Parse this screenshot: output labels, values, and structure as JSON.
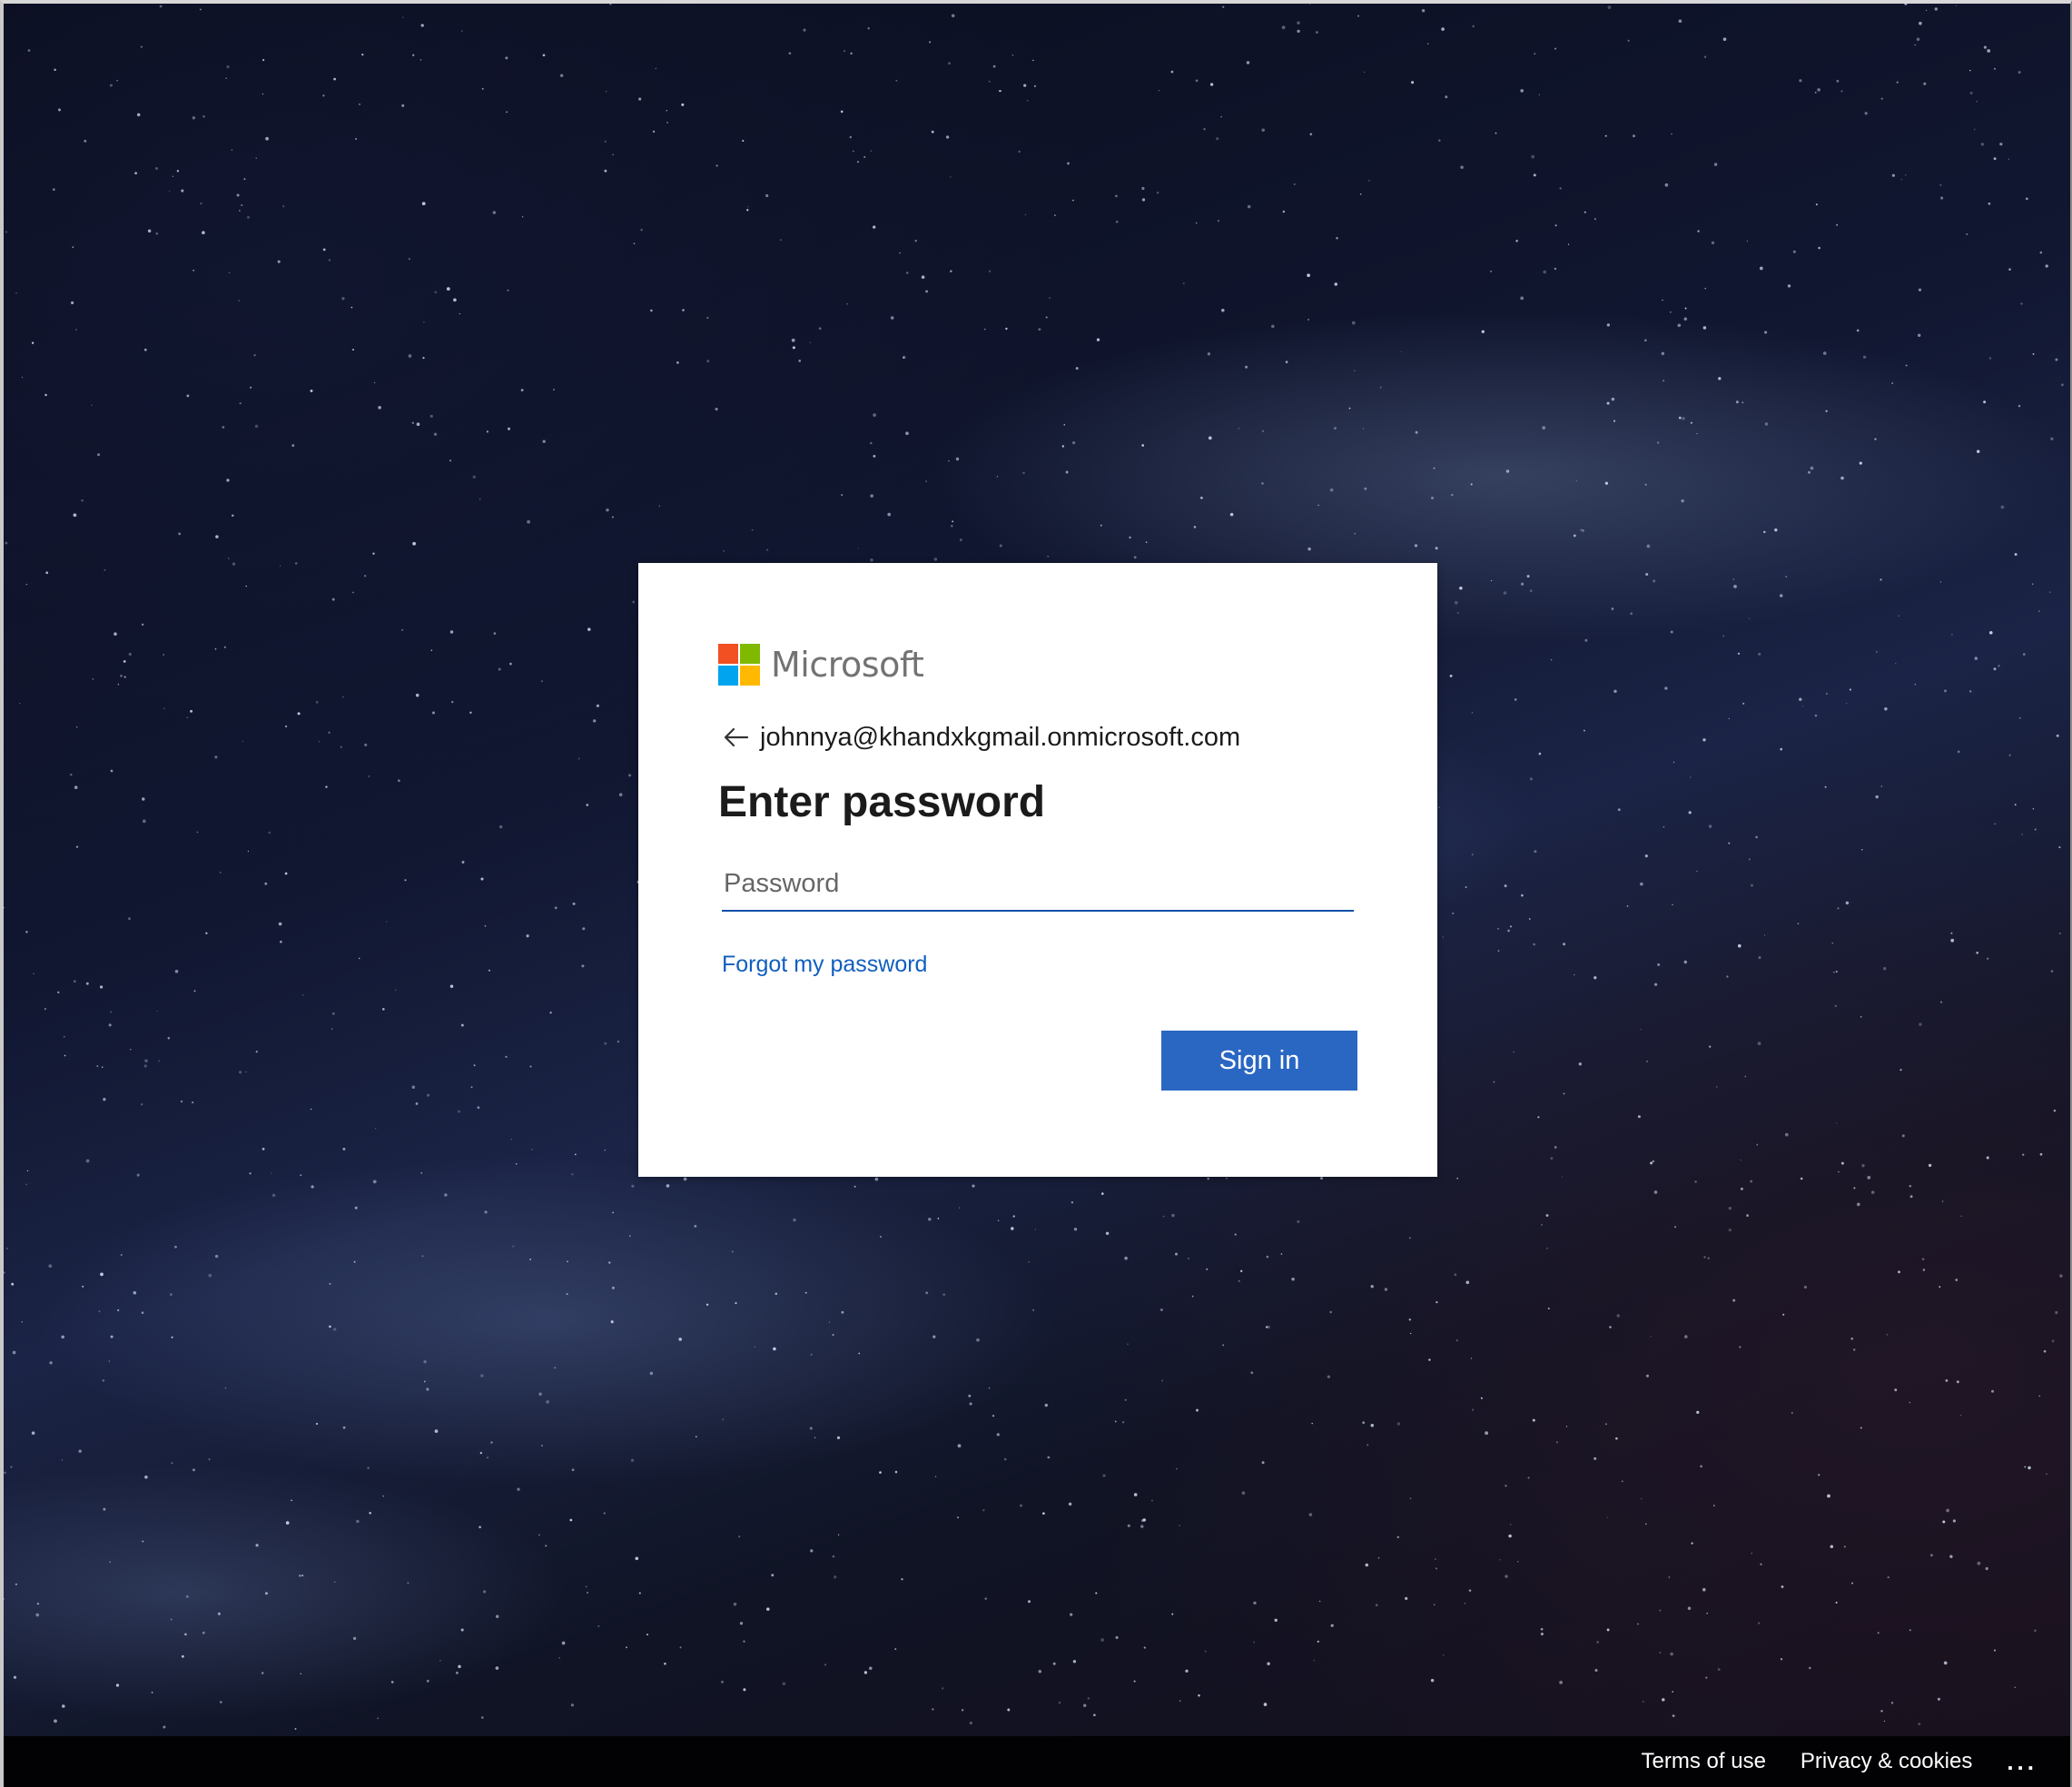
{
  "brand": {
    "name": "Microsoft",
    "colors": {
      "red": "#f25022",
      "green": "#7fba00",
      "blue": "#00a4ef",
      "yellow": "#ffb900"
    }
  },
  "signin": {
    "identity": "johnnya@khandxkgmail.onmicrosoft.com",
    "back_icon": "arrow-left-icon",
    "title": "Enter password",
    "password_placeholder": "Password",
    "password_value": "",
    "forgot_label": "Forgot my password",
    "submit_label": "Sign in",
    "accent": "#2a67c3"
  },
  "footer": {
    "terms_label": "Terms of use",
    "privacy_label": "Privacy & cookies",
    "more_label": "..."
  }
}
